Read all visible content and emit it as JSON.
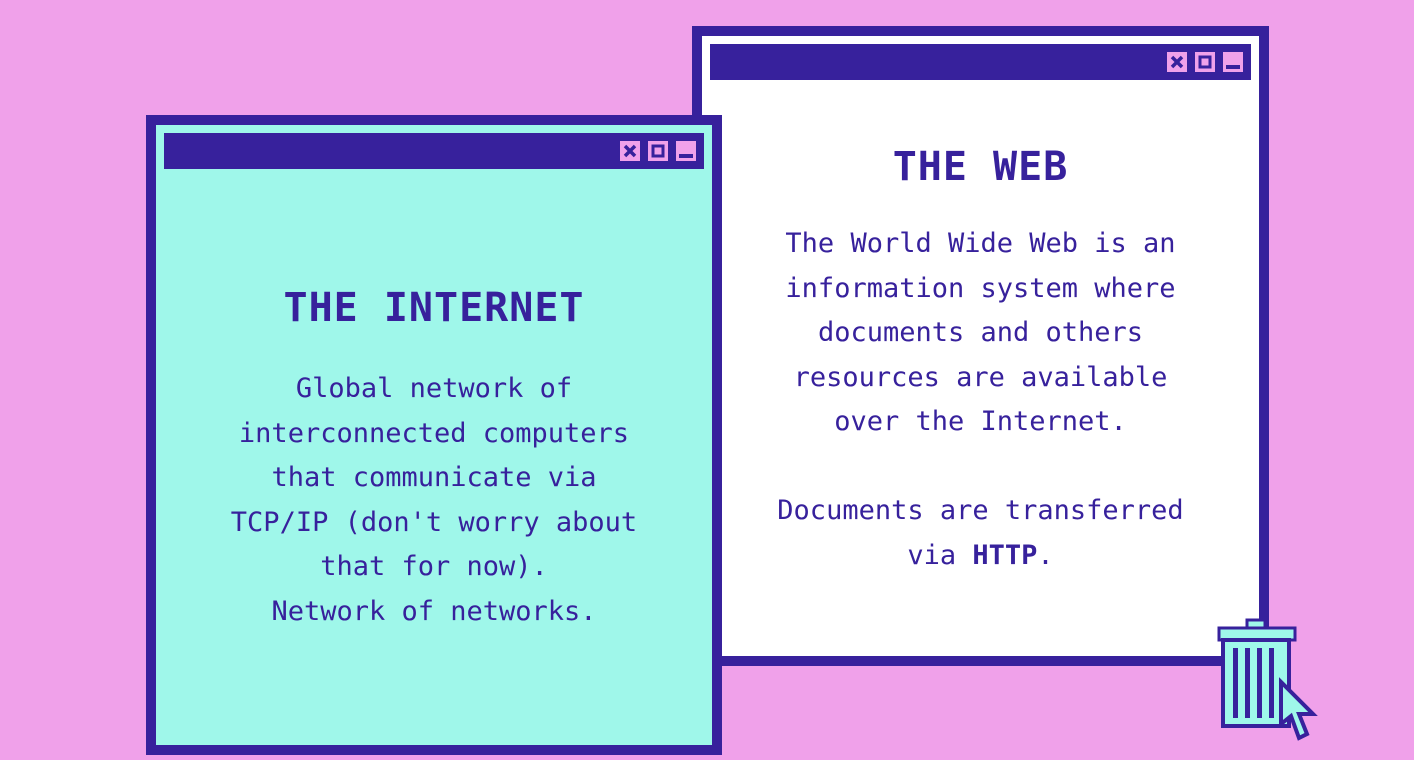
{
  "colors": {
    "background": "#f0a1ea",
    "ink": "#37219c",
    "internet_window": "#9ff7ea",
    "web_window": "#ffffff"
  },
  "internet_window": {
    "title": "THE INTERNET",
    "paragraph": "Global network of\ninterconnected computers\nthat communicate via\nTCP/IP (don't worry about\nthat for now).\nNetwork of networks.",
    "controls": [
      "close-icon",
      "maximize-icon",
      "minimize-icon"
    ]
  },
  "web_window": {
    "title": "THE WEB",
    "paragraph": "The World Wide Web is an\ninformation system where\ndocuments and others\nresources are available\nover the Internet.",
    "paragraph2_prefix": "Documents are transferred\nvia ",
    "paragraph2_strong": "HTTP",
    "paragraph2_suffix": ".",
    "controls": [
      "close-icon",
      "maximize-icon",
      "minimize-icon"
    ]
  },
  "desktop": {
    "icons": [
      "trash-can-icon",
      "cursor-arrow-icon"
    ]
  }
}
